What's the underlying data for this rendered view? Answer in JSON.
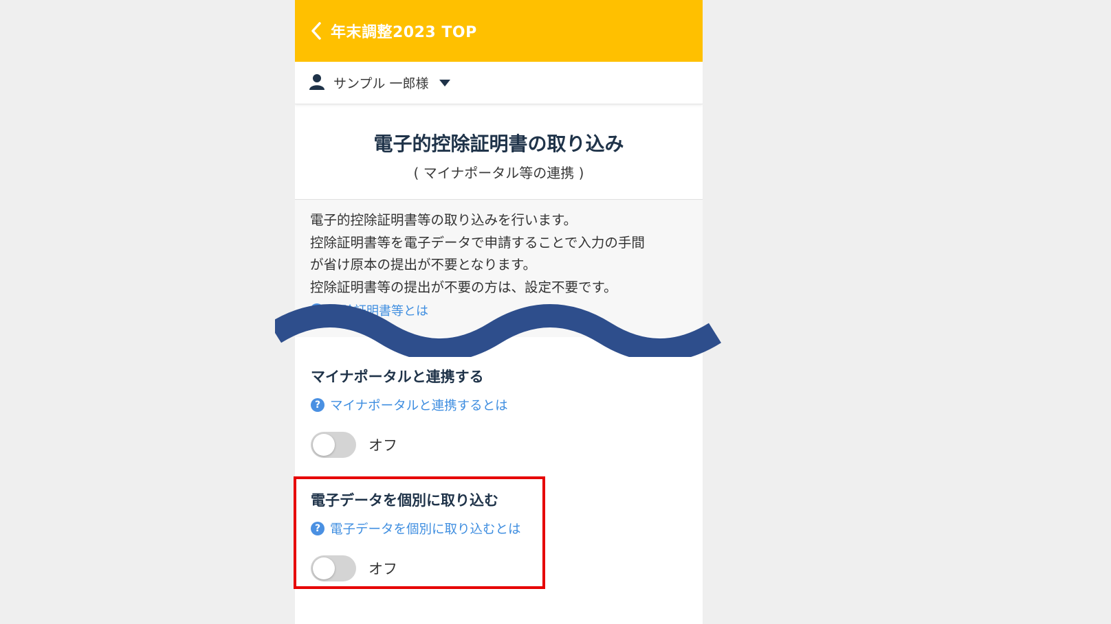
{
  "header": {
    "back_icon": "chevron-left-icon",
    "title": "年末調整2023 TOP",
    "color": "#ffc000"
  },
  "user": {
    "icon": "person-icon",
    "name": "サンプル 一郎様",
    "dropdown_icon": "caret-down-icon"
  },
  "page": {
    "title": "電子的控除証明書の取り込み",
    "subtitle": "( マイナポータル等の連携 )"
  },
  "description": {
    "lines": [
      "電子的控除証明書等の取り込みを行います。",
      "控除証明書等を電子データで申請することで入力の手間",
      "が省け原本の提出が不要となります。",
      "控除証明書等の提出が不要の方は、設定不要です。"
    ],
    "help_link_partial": "控除証明書等とは"
  },
  "sections": [
    {
      "title": "マイナポータルと連携する",
      "help_link": "マイナポータルと連携するとは",
      "toggle_state": "off",
      "toggle_label": "オフ"
    },
    {
      "title": "電子データを個別に取り込む",
      "help_link": "電子データを個別に取り込むとは",
      "toggle_state": "off",
      "toggle_label": "オフ"
    }
  ],
  "colors": {
    "link": "#3f8ee0",
    "title": "#1f3349",
    "wave": "#2e4e8c",
    "highlight": "#e60000"
  }
}
